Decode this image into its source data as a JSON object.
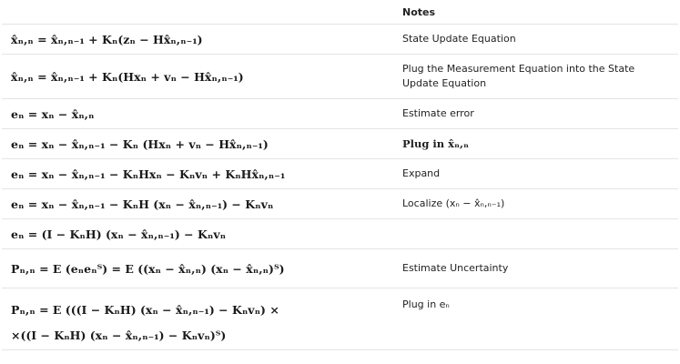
{
  "table": {
    "header": {
      "equation": "",
      "notes": "Notes"
    },
    "rows": [
      {
        "equation": "x̂ₙ,ₙ = x̂ₙ,ₙ₋₁ + Kₙ(zₙ − Hx̂ₙ,ₙ₋₁)",
        "note": "State Update Equation"
      },
      {
        "equation": "x̂ₙ,ₙ = x̂ₙ,ₙ₋₁ + Kₙ(Hxₙ + vₙ − Hx̂ₙ,ₙ₋₁)",
        "note": "Plug the Measurement Equation into the State Update Equation"
      },
      {
        "equation": "eₙ = xₙ − x̂ₙ,ₙ",
        "note": "Estimate error"
      },
      {
        "equation": "eₙ = xₙ − x̂ₙ,ₙ₋₁ − Kₙ (Hxₙ + vₙ − Hx̂ₙ,ₙ₋₁)",
        "note": "Plug in x̂ₙ,ₙ"
      },
      {
        "equation": "eₙ = xₙ − x̂ₙ,ₙ₋₁ − KₙHxₙ − Kₙvₙ + KₙHx̂ₙ,ₙ₋₁",
        "note": "Expand"
      },
      {
        "equation": "eₙ = xₙ − x̂ₙ,ₙ₋₁ − KₙH (xₙ − x̂ₙ,ₙ₋₁) − Kₙvₙ",
        "note": "Localize (xₙ − x̂ₙ,ₙ₋₁)"
      },
      {
        "equation": "eₙ = (I − KₙH) (xₙ − x̂ₙ,ₙ₋₁) − Kₙvₙ",
        "note": ""
      },
      {
        "equation": "Pₙ,ₙ = E (eₙeₙᵀ) = E ((xₙ − x̂ₙ,ₙ) (xₙ − x̂ₙ,ₙ)ᵀ)",
        "note": "Estimate Uncertainty"
      },
      {
        "equation": "Pₙ,ₙ = E (((I − KₙH) (xₙ − x̂ₙ,ₙ₋₁) − Kₙvₙ) ×",
        "equation_line2": "×((I − KₙH) (xₙ − x̂ₙ,ₙ₋₁) − Kₙvₙ)ᵀ)",
        "note": "Plug in eₙ"
      }
    ]
  }
}
